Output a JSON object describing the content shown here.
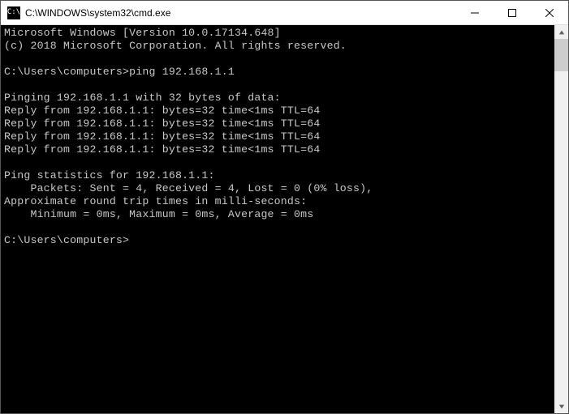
{
  "titlebar": {
    "icon_text": "C:\\",
    "title": "C:\\WINDOWS\\system32\\cmd.exe"
  },
  "terminal": {
    "lines": [
      "Microsoft Windows [Version 10.0.17134.648]",
      "(c) 2018 Microsoft Corporation. All rights reserved.",
      "",
      "C:\\Users\\computers>ping 192.168.1.1",
      "",
      "Pinging 192.168.1.1 with 32 bytes of data:",
      "Reply from 192.168.1.1: bytes=32 time<1ms TTL=64",
      "Reply from 192.168.1.1: bytes=32 time<1ms TTL=64",
      "Reply from 192.168.1.1: bytes=32 time<1ms TTL=64",
      "Reply from 192.168.1.1: bytes=32 time<1ms TTL=64",
      "",
      "Ping statistics for 192.168.1.1:",
      "    Packets: Sent = 4, Received = 4, Lost = 0 (0% loss),",
      "Approximate round trip times in milli-seconds:",
      "    Minimum = 0ms, Maximum = 0ms, Average = 0ms",
      "",
      "C:\\Users\\computers>"
    ]
  }
}
